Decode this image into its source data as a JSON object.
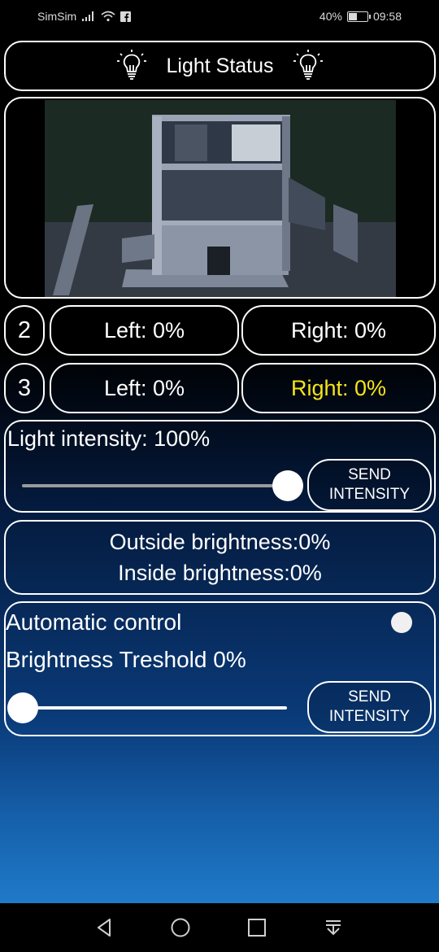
{
  "status_bar": {
    "carrier": "SimSim",
    "battery_text": "40%",
    "battery_level": 0.4,
    "time": "09:58"
  },
  "header": {
    "title": "Light Status"
  },
  "rooms": [
    {
      "number": "2",
      "left": "Left: 0%",
      "right": "Right: 0%",
      "right_color": "#ffffff"
    },
    {
      "number": "3",
      "left": "Left: 0%",
      "right": "Right: 0%",
      "right_color": "#f5e41a"
    }
  ],
  "intensity": {
    "label": "Light intensity: 100%",
    "slider_value": 1.0,
    "button_label": "SEND\nINTENSITY"
  },
  "brightness": {
    "outside": "Outside brightness:0%",
    "inside": "Inside brightness:0%"
  },
  "automatic": {
    "label": "Automatic control",
    "threshold_label": "Brightness Treshold 0%",
    "threshold_value": 0.0,
    "button_label": "SEND\nINTENSITY"
  },
  "colors": {
    "accent_yellow": "#f5e41a",
    "border": "#ffffff"
  },
  "icons": [
    "signal-icon",
    "wifi-icon",
    "facebook-icon",
    "battery-icon",
    "lightbulb-icon",
    "back-icon",
    "home-icon",
    "recents-icon",
    "notification-pull-icon"
  ]
}
